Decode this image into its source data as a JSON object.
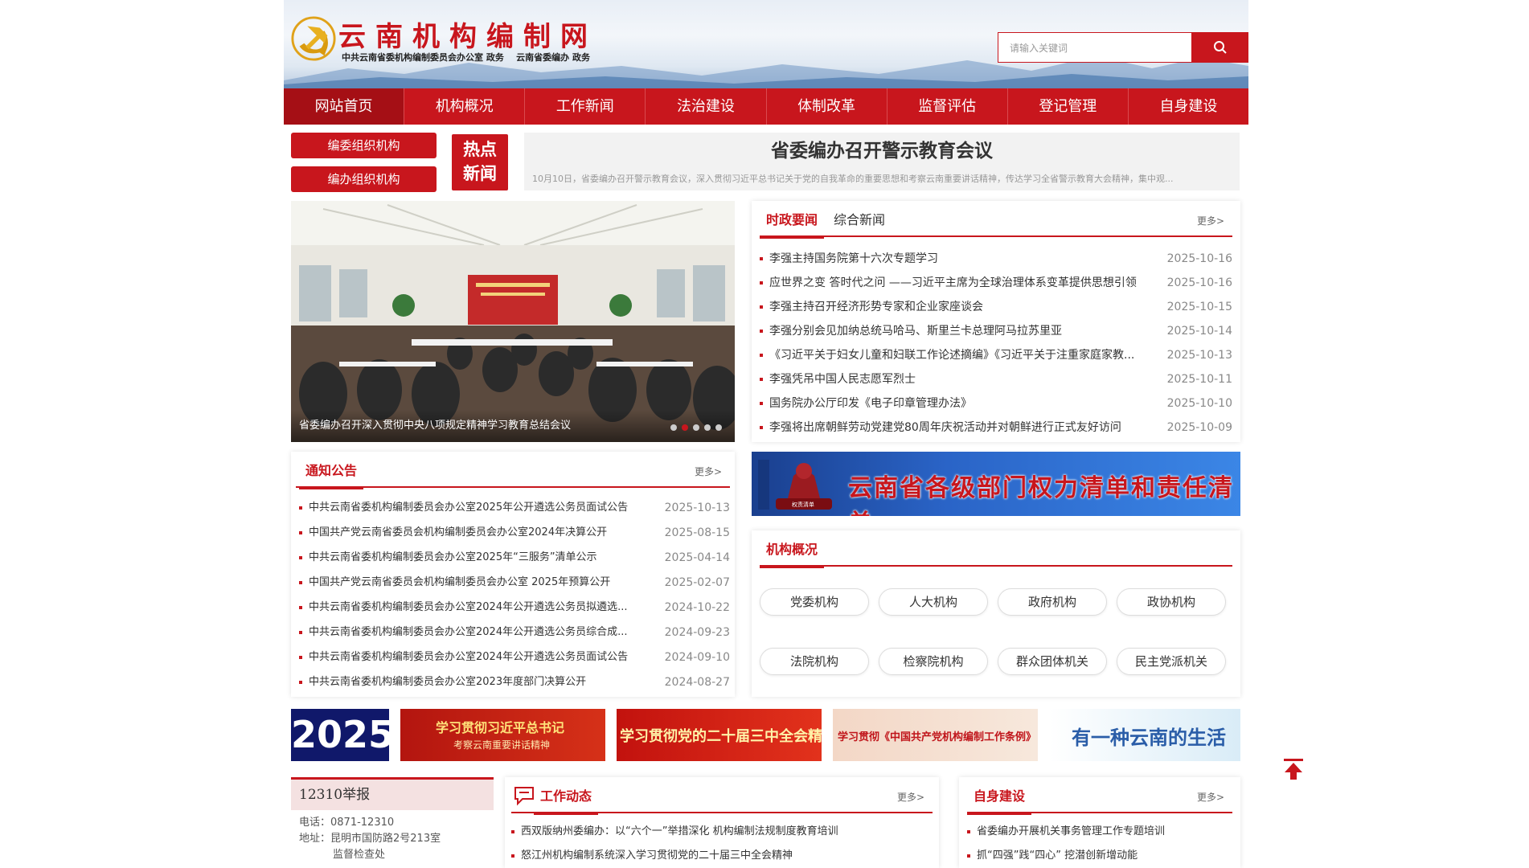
{
  "header": {
    "title": "云南机构编制网",
    "subtitle": "中共云南省委机构编制委员会办公室 政务    云南省委编办 政务",
    "search_placeholder": "请输入关键词"
  },
  "nav": [
    "网站首页",
    "机构概况",
    "工作新闻",
    "法治建设",
    "体制改革",
    "监督评估",
    "登记管理",
    "自身建设"
  ],
  "org_buttons": [
    "编委组织机构",
    "编办组织机构"
  ],
  "hot_news": {
    "badge": "热点\n新闻",
    "title": "省委编办召开警示教育会议",
    "summary": "10月10日，省委编办召开警示教育会议，深入贯彻习近平总书记关于党的自我革命的重要思想和考察云南重要讲话精神，传达学习全省警示教育大会精神，集中观..."
  },
  "slider": {
    "caption": "省委编办召开深入贯彻中央八项规定精神学习教育总结会议",
    "dots": 5,
    "active_dot": 1
  },
  "news_panel": {
    "tabs": [
      "时政要闻",
      "综合新闻"
    ],
    "more": "更多>",
    "items": [
      {
        "title": "李强主持国务院第十六次专题学习",
        "date": "2025-10-16"
      },
      {
        "title": "应世界之变 答时代之问 ——习近平主席为全球治理体系变革提供思想引领",
        "date": "2025-10-16"
      },
      {
        "title": "李强主持召开经济形势专家和企业家座谈会",
        "date": "2025-10-15"
      },
      {
        "title": "李强分别会见加纳总统马哈马、斯里兰卡总理阿马拉苏里亚",
        "date": "2025-10-14"
      },
      {
        "title": "《习近平关于妇女儿童和妇联工作论述摘编》《习近平关于注重家庭家教...",
        "date": "2025-10-13"
      },
      {
        "title": "李强凭吊中国人民志愿军烈士",
        "date": "2025-10-11"
      },
      {
        "title": "国务院办公厅印发《电子印章管理办法》",
        "date": "2025-10-10"
      },
      {
        "title": "李强将出席朝鲜劳动党建党80周年庆祝活动并对朝鲜进行正式友好访问",
        "date": "2025-10-09"
      }
    ]
  },
  "notice_panel": {
    "title": "通知公告",
    "more": "更多>",
    "items": [
      {
        "title": "中共云南省委机构编制委员会办公室2025年公开遴选公务员面试公告",
        "date": "2025-10-13"
      },
      {
        "title": "中国共产党云南省委员会机构编制委员会办公室2024年决算公开",
        "date": "2025-08-15"
      },
      {
        "title": "中共云南省委机构编制委员会办公室2025年“三服务”清单公示",
        "date": "2025-04-14"
      },
      {
        "title": "中国共产党云南省委员会机构编制委员会办公室 2025年预算公开",
        "date": "2025-02-07"
      },
      {
        "title": "中共云南省委机构编制委员会办公室2024年公开遴选公务员拟遴选...",
        "date": "2024-10-22"
      },
      {
        "title": "中共云南省委机构编制委员会办公室2024年公开遴选公务员综合成...",
        "date": "2024-09-23"
      },
      {
        "title": "中共云南省委机构编制委员会办公室2024年公开遴选公务员面试公告",
        "date": "2024-09-10"
      },
      {
        "title": "中共云南省委机构编制委员会办公室2023年度部门决算公开",
        "date": "2024-08-27"
      }
    ]
  },
  "power_list_banner": "云南省各级部门权力清单和责任清单",
  "power_list_stamp": "权责清单",
  "org_overview": {
    "title": "机构概况",
    "tags": [
      "党委机构",
      "人大机构",
      "政府机构",
      "政协机构",
      "法院机构",
      "检察院机构",
      "群众团体机关",
      "民主党派机关"
    ]
  },
  "promos": [
    {
      "text": "2025",
      "sub": ""
    },
    {
      "text": "学习贯彻习近平总书记",
      "sub": "考察云南重要讲话精神"
    },
    {
      "text": "学习贯彻党的二十届三中全会精神",
      "sub": ""
    },
    {
      "text": "学习贯彻《中国共产党机构编制工作条例》",
      "sub": ""
    },
    {
      "text": "有一种云南的生活",
      "sub": ""
    }
  ],
  "report": {
    "title": "12310举报",
    "phone_label": "电话：",
    "phone": "0871-12310",
    "addr_label": "地址：",
    "addr": "昆明市国防路2号213室",
    "addr2": "监督检查处"
  },
  "work_panel": {
    "title": "工作动态",
    "more": "更多>",
    "items": [
      "西双版纳州委编办：以“六个一”举措深化 机构编制法规制度教育培训",
      "怒江州机构编制系统深入学习贯彻党的二十届三中全会精神"
    ]
  },
  "self_panel": {
    "title": "自身建设",
    "more": "更多>",
    "items": [
      "省委编办开展机关事务管理工作专题培训",
      "抓“四强”践“四心” 挖潜创新增动能"
    ]
  },
  "colors": {
    "brand_red": "#c8161d",
    "dark_red": "#a50f15"
  },
  "icons": [
    "party-emblem-icon",
    "search-icon",
    "back-to-top-icon",
    "chat-icon"
  ]
}
